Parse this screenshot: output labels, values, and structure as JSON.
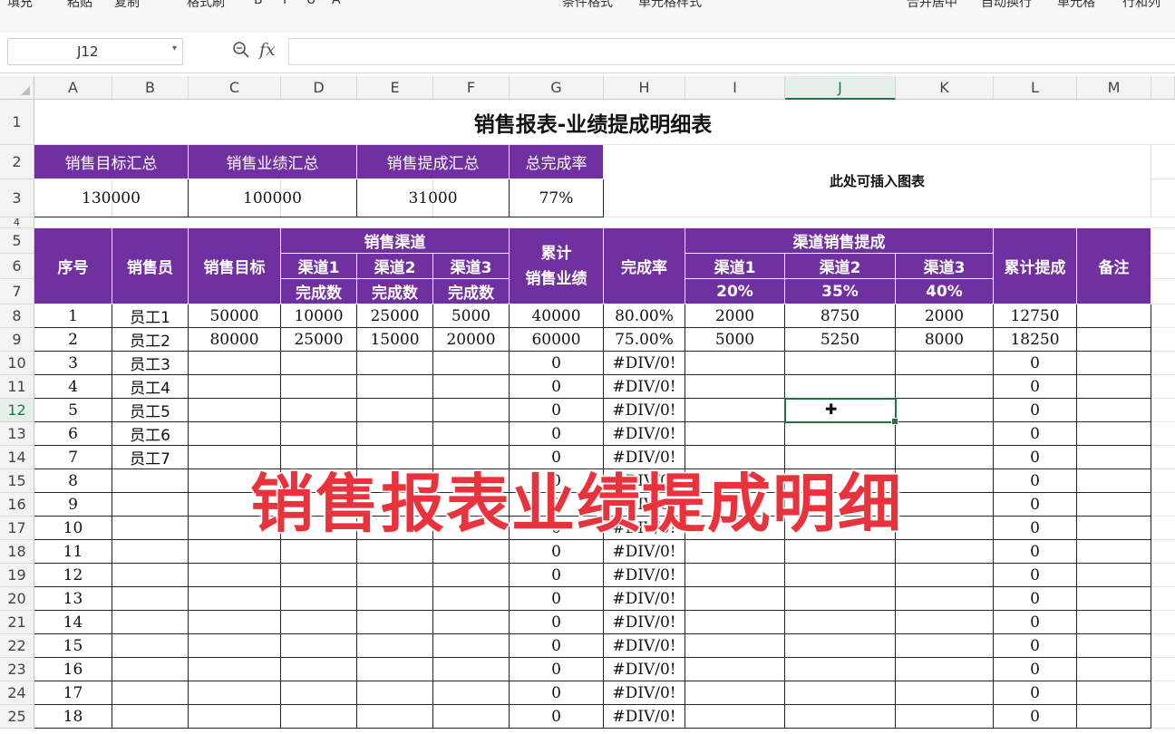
{
  "toolbar": {
    "items": [
      "填充",
      "粘贴",
      "复制",
      "格式刷",
      "B",
      "I",
      "U",
      "A",
      "条件格式",
      "单元格样式",
      "合并居中",
      "自动换行",
      "单元格",
      "行和列"
    ]
  },
  "formula_bar": {
    "cell_ref": "J12",
    "formula": "",
    "fx": "fx"
  },
  "columns": [
    "A",
    "B",
    "C",
    "D",
    "E",
    "F",
    "G",
    "H",
    "I",
    "J",
    "K",
    "L",
    "M"
  ],
  "selected_column": "J",
  "selected_row": "12",
  "rows": [
    "1",
    "2",
    "3",
    "4",
    "5",
    "6",
    "7",
    "8",
    "9",
    "10",
    "11",
    "12",
    "13",
    "14",
    "15",
    "16",
    "17",
    "18",
    "19",
    "20",
    "21",
    "22",
    "23",
    "24",
    "25"
  ],
  "title": "销售报表-业绩提成明细表",
  "summary": {
    "headers": [
      "销售目标汇总",
      "销售业绩汇总",
      "销售提成汇总",
      "总完成率"
    ],
    "values": [
      "130000",
      "100000",
      "31000",
      "77%"
    ],
    "chart_placeholder": "此处可插入图表"
  },
  "table_header": {
    "seq": "序号",
    "salesperson": "销售员",
    "target": "销售目标",
    "channel_group": "销售渠道",
    "channels": [
      "渠道1",
      "渠道2",
      "渠道3"
    ],
    "completed": "完成数",
    "cumulative_sales": "累计\n销售业绩",
    "rate": "完成率",
    "commission_group": "渠道销售提成",
    "commission_rates": [
      "20%",
      "35%",
      "40%"
    ],
    "cumulative_commission": "累计提成",
    "remark": "备注"
  },
  "data_rows": [
    {
      "seq": "1",
      "name": "员工1",
      "target": "50000",
      "c1": "10000",
      "c2": "25000",
      "c3": "5000",
      "sales": "40000",
      "rate": "80.00%",
      "p1": "2000",
      "p2": "8750",
      "p3": "2000",
      "total": "12750"
    },
    {
      "seq": "2",
      "name": "员工2",
      "target": "80000",
      "c1": "25000",
      "c2": "15000",
      "c3": "20000",
      "sales": "60000",
      "rate": "75.00%",
      "p1": "5000",
      "p2": "5250",
      "p3": "8000",
      "total": "18250"
    },
    {
      "seq": "3",
      "name": "员工3",
      "target": "",
      "c1": "",
      "c2": "",
      "c3": "",
      "sales": "0",
      "rate": "#DIV/0!",
      "p1": "",
      "p2": "",
      "p3": "",
      "total": "0"
    },
    {
      "seq": "4",
      "name": "员工4",
      "target": "",
      "c1": "",
      "c2": "",
      "c3": "",
      "sales": "0",
      "rate": "#DIV/0!",
      "p1": "",
      "p2": "",
      "p3": "",
      "total": "0"
    },
    {
      "seq": "5",
      "name": "员工5",
      "target": "",
      "c1": "",
      "c2": "",
      "c3": "",
      "sales": "0",
      "rate": "#DIV/0!",
      "p1": "",
      "p2": "",
      "p3": "",
      "total": "0"
    },
    {
      "seq": "6",
      "name": "员工6",
      "target": "",
      "c1": "",
      "c2": "",
      "c3": "",
      "sales": "0",
      "rate": "#DIV/0!",
      "p1": "",
      "p2": "",
      "p3": "",
      "total": "0"
    },
    {
      "seq": "7",
      "name": "员工7",
      "target": "",
      "c1": "",
      "c2": "",
      "c3": "",
      "sales": "0",
      "rate": "#DIV/0!",
      "p1": "",
      "p2": "",
      "p3": "",
      "total": "0"
    },
    {
      "seq": "8",
      "name": "",
      "target": "",
      "c1": "",
      "c2": "",
      "c3": "",
      "sales": "0",
      "rate": "#DIV/0!",
      "p1": "",
      "p2": "",
      "p3": "",
      "total": "0"
    },
    {
      "seq": "9",
      "name": "",
      "target": "",
      "c1": "",
      "c2": "",
      "c3": "",
      "sales": "0",
      "rate": "#DIV/0!",
      "p1": "",
      "p2": "",
      "p3": "",
      "total": "0"
    },
    {
      "seq": "10",
      "name": "",
      "target": "",
      "c1": "",
      "c2": "",
      "c3": "",
      "sales": "0",
      "rate": "#DIV/0!",
      "p1": "",
      "p2": "",
      "p3": "",
      "total": "0"
    },
    {
      "seq": "11",
      "name": "",
      "target": "",
      "c1": "",
      "c2": "",
      "c3": "",
      "sales": "0",
      "rate": "#DIV/0!",
      "p1": "",
      "p2": "",
      "p3": "",
      "total": "0"
    },
    {
      "seq": "12",
      "name": "",
      "target": "",
      "c1": "",
      "c2": "",
      "c3": "",
      "sales": "0",
      "rate": "#DIV/0!",
      "p1": "",
      "p2": "",
      "p3": "",
      "total": "0"
    },
    {
      "seq": "13",
      "name": "",
      "target": "",
      "c1": "",
      "c2": "",
      "c3": "",
      "sales": "0",
      "rate": "#DIV/0!",
      "p1": "",
      "p2": "",
      "p3": "",
      "total": "0"
    },
    {
      "seq": "14",
      "name": "",
      "target": "",
      "c1": "",
      "c2": "",
      "c3": "",
      "sales": "0",
      "rate": "#DIV/0!",
      "p1": "",
      "p2": "",
      "p3": "",
      "total": "0"
    },
    {
      "seq": "15",
      "name": "",
      "target": "",
      "c1": "",
      "c2": "",
      "c3": "",
      "sales": "0",
      "rate": "#DIV/0!",
      "p1": "",
      "p2": "",
      "p3": "",
      "total": "0"
    },
    {
      "seq": "16",
      "name": "",
      "target": "",
      "c1": "",
      "c2": "",
      "c3": "",
      "sales": "0",
      "rate": "#DIV/0!",
      "p1": "",
      "p2": "",
      "p3": "",
      "total": "0"
    },
    {
      "seq": "17",
      "name": "",
      "target": "",
      "c1": "",
      "c2": "",
      "c3": "",
      "sales": "0",
      "rate": "#DIV/0!",
      "p1": "",
      "p2": "",
      "p3": "",
      "total": "0"
    },
    {
      "seq": "18",
      "name": "",
      "target": "",
      "c1": "",
      "c2": "",
      "c3": "",
      "sales": "0",
      "rate": "#DIV/0!",
      "p1": "",
      "p2": "",
      "p3": "",
      "total": "0"
    }
  ],
  "overlay_text": "销售报表业绩提成明细",
  "colors": {
    "header_purple": "#7030a0",
    "selection_green": "#217346",
    "overlay_red": "#e8323c"
  }
}
